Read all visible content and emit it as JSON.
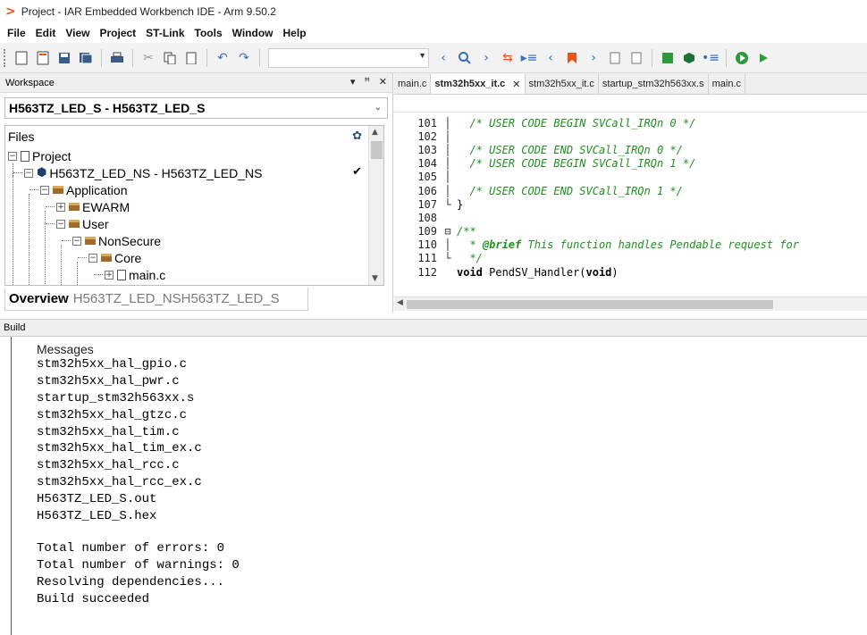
{
  "window": {
    "title": "Project - IAR Embedded Workbench IDE - Arm 9.50.2",
    "logo": ">"
  },
  "menu": [
    "File",
    "Edit",
    "View",
    "Project",
    "ST-Link",
    "Tools",
    "Window",
    "Help"
  ],
  "workspace": {
    "header": "Workspace",
    "ctrl_dropdown": "▾",
    "ctrl_pin": "ꟸ",
    "ctrl_close": "✕",
    "config": "H563TZ_LED_S - H563TZ_LED_S",
    "files_label": "Files",
    "tree": {
      "project": "Project",
      "ns_project": "H563TZ_LED_NS - H563TZ_LED_NS",
      "ns_check": "✔",
      "application": "Application",
      "ewarm": "EWARM",
      "user": "User",
      "nonsecure": "NonSecure",
      "core": "Core",
      "mainc": "main.c"
    },
    "tabs": {
      "active": "Overview",
      "inactive": "H563TZ_LED_NSH563TZ_LED_S"
    }
  },
  "editor": {
    "tabs": [
      {
        "label": "main.c"
      },
      {
        "label": "stm32h5xx_it.c",
        "close": "✕"
      },
      {
        "label": "stm32h5xx_it.c"
      },
      {
        "label": "startup_stm32h563xx.s"
      },
      {
        "label": "main.c"
      }
    ],
    "lines": [
      {
        "n": "101",
        "gutter": "│",
        "text": "  /* USER CODE BEGIN SVCall_IRQn 0 */"
      },
      {
        "n": "102",
        "gutter": "│",
        "text": ""
      },
      {
        "n": "103",
        "gutter": "│",
        "text": "  /* USER CODE END SVCall_IRQn 0 */"
      },
      {
        "n": "104",
        "gutter": "│",
        "text": "  /* USER CODE BEGIN SVCall_IRQn 1 */"
      },
      {
        "n": "105",
        "gutter": "│",
        "text": ""
      },
      {
        "n": "106",
        "gutter": "│",
        "text": "  /* USER CODE END SVCall_IRQn 1 */"
      },
      {
        "n": "107",
        "gutter": "└",
        "text": "}"
      },
      {
        "n": "108",
        "gutter": "",
        "text": ""
      },
      {
        "n": "109",
        "gutter": "⊟",
        "text": "/**"
      },
      {
        "n": "110",
        "gutter": "│",
        "text_pre": "  * ",
        "text_tag": "@brief",
        "text_post": " This function handles Pendable request for"
      },
      {
        "n": "111",
        "gutter": "└",
        "text": "  */"
      },
      {
        "n": "112",
        "gutter": "",
        "kw1": "void",
        "mid": " PendSV_Handler(",
        "kw2": "void",
        "end": ")"
      }
    ]
  },
  "build": {
    "header": "Build",
    "messages_label": "Messages",
    "lines": [
      "stm32h5xx_hal_gpio.c",
      "stm32h5xx_hal_pwr.c",
      "startup_stm32h563xx.s",
      "stm32h5xx_hal_gtzc.c",
      "stm32h5xx_hal_tim.c",
      "stm32h5xx_hal_tim_ex.c",
      "stm32h5xx_hal_rcc.c",
      "stm32h5xx_hal_rcc_ex.c",
      "H563TZ_LED_S.out",
      "H563TZ_LED_S.hex"
    ],
    "summary": [
      "Total number of errors: 0",
      "Total number of warnings: 0",
      "Resolving dependencies...",
      "Build succeeded"
    ]
  }
}
